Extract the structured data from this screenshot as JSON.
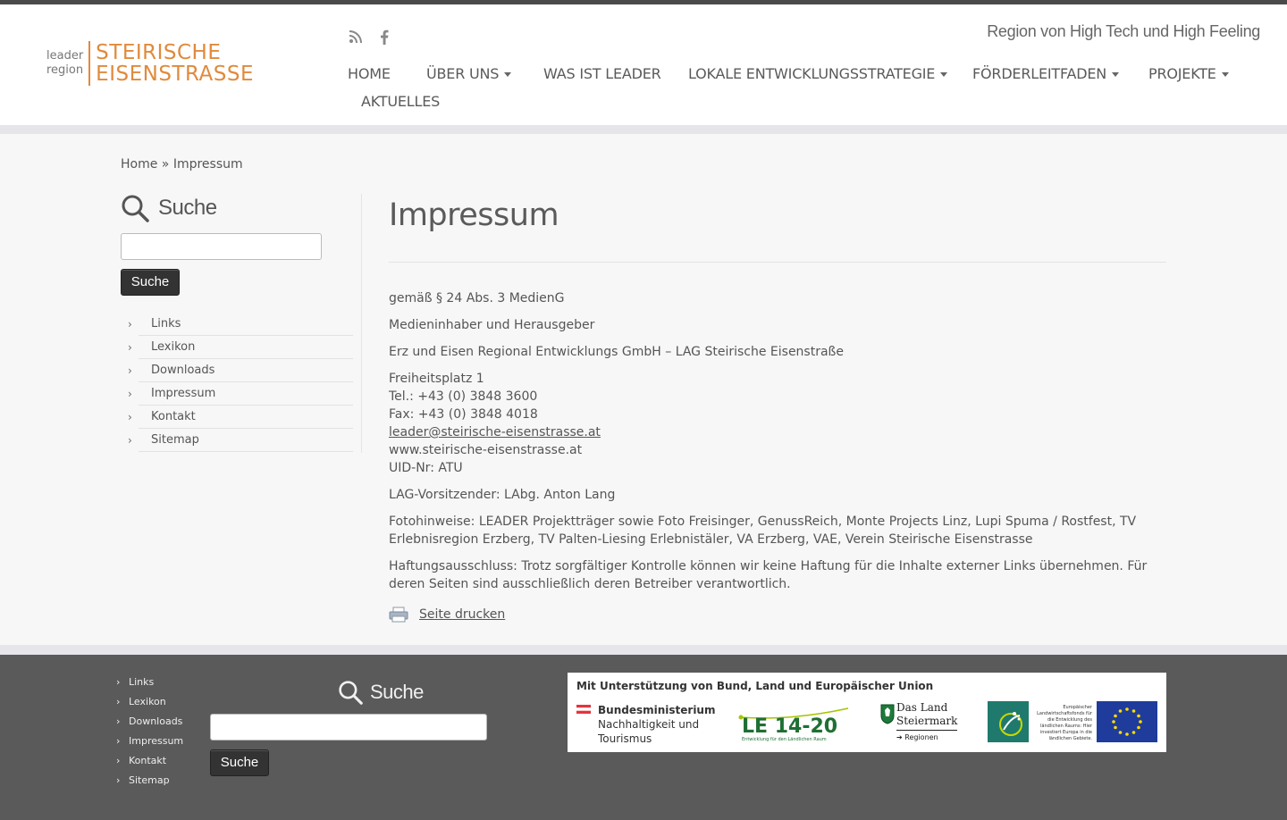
{
  "header": {
    "logo_small_line1": "leader",
    "logo_small_line2": "region",
    "logo_big_line1": "STEIRISCHE",
    "logo_big_line2": "EISENSTRASSE",
    "tagline": "Region von High Tech und High Feeling",
    "social": [
      "rss-icon",
      "facebook-icon"
    ]
  },
  "nav": {
    "items": [
      {
        "label": "HOME"
      },
      {
        "label": "ÜBER UNS"
      },
      {
        "label": "WAS IST LEADER"
      },
      {
        "label": "LOKALE ENTWICKLUNGSSTRATEGIE"
      },
      {
        "label": "FÖRDERLEITFADEN"
      },
      {
        "label": "PROJEKTE"
      },
      {
        "label": "AKTUELLES"
      }
    ]
  },
  "breadcrumb": {
    "home": "Home",
    "separator": "»",
    "current": "Impressum"
  },
  "sidebar": {
    "search_title": "Suche",
    "search_value": "",
    "search_button": "Suche",
    "menu": [
      "Links",
      "Lexikon",
      "Downloads",
      "Impressum",
      "Kontakt",
      "Sitemap"
    ]
  },
  "content": {
    "title": "Impressum",
    "line1": "gemäß § 24 Abs. 3 MedienG",
    "line2": "Medieninhaber und Herausgeber",
    "line3": "Erz und Eisen Regional Entwicklungs GmbH – LAG Steirische Eisenstraße",
    "address1": "Freiheitsplatz 1",
    "tel": "Tel.: +43 (0) 3848 3600",
    "fax": "Fax: +43 (0) 3848 4018",
    "email": "leader@steirische-eisenstrasse.at ",
    "web": "www.steirische-eisenstrasse.at",
    "uid": "UID-Nr: ATU",
    "chair": "LAG-Vorsitzender: LAbg. Anton Lang",
    "photos": "Fotohinweise: LEADER Projektträger sowie Foto Freisinger, GenussReich, Monte Projects Linz, Lupi Spuma / Rostfest, TV Erlebnisregion Erzberg, TV Palten-Liesing Erlebnistäler, VA Erzberg, VAE, Verein Steirische Eisenstrasse",
    "disclaimer": "Haftungsausschluss: Trotz sorgfältiger Kontrolle können wir keine Haftung für die Inhalte externer Links übernehmen. Für deren Seiten sind ausschließlich deren Betreiber verantwortlich.",
    "print_label": "Seite drucken"
  },
  "footer": {
    "menu": [
      "Links",
      "Lexikon",
      "Downloads",
      "Impressum",
      "Kontakt",
      "Sitemap"
    ],
    "search_title": "Suche",
    "search_value": "",
    "search_button": "Suche",
    "banner_head": "Mit Unterstützung von Bund, Land und Europäischer Union",
    "banner_ministry_1": "Bundesministerium",
    "banner_ministry_2": "Nachhaltigkeit und",
    "banner_ministry_3": "Tourismus",
    "banner_le": "LE 14-20",
    "banner_le_sub": "Entwicklung für den Ländlichen Raum",
    "banner_land_1": "Das Land",
    "banner_land_2": "Steiermark",
    "banner_land_3": "➔ Regionen",
    "banner_eu_text": "Europäischer Landwirtschaftsfonds für die Entwicklung des ländlichen Raums: Hier investiert Europa in die ländlichen Gebiete."
  },
  "colors": {
    "accent": "#e08a3c",
    "footer_bg": "#5a5a5a",
    "button_bg": "#333333"
  }
}
